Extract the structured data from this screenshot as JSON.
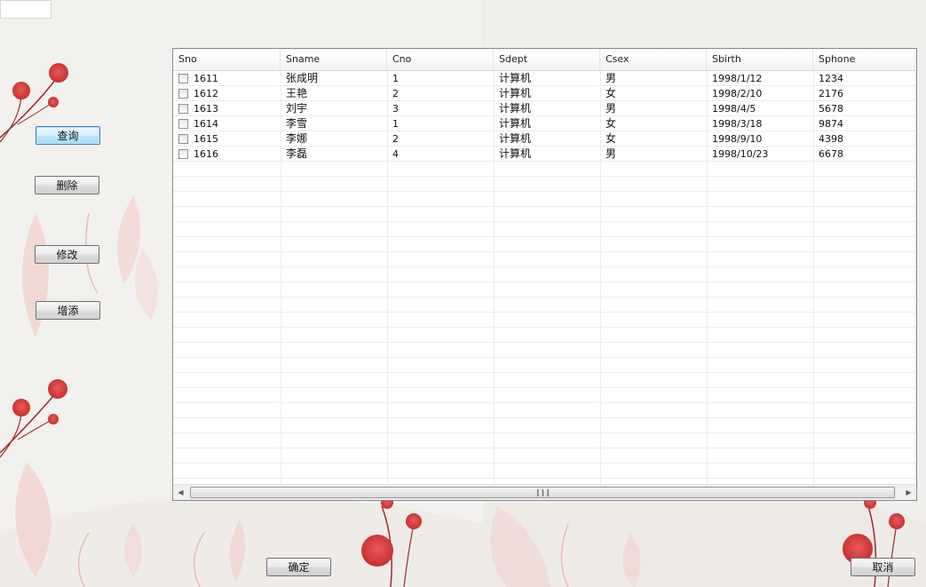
{
  "buttons": {
    "query": "查询",
    "delete": "删除",
    "modify": "修改",
    "add": "增添",
    "confirm": "确定",
    "cancel": "取消"
  },
  "table": {
    "columns": [
      "Sno",
      "Sname",
      "Cno",
      "Sdept",
      "Csex",
      "Sbirth",
      "Sphone"
    ],
    "rows": [
      [
        "1611",
        "张成明",
        "1",
        "计算机",
        "男",
        "1998/1/12",
        "1234"
      ],
      [
        "1612",
        "王艳",
        "2",
        "计算机",
        "女",
        "1998/2/10",
        "2176"
      ],
      [
        "1613",
        "刘宇",
        "3",
        "计算机",
        "男",
        "1998/4/5",
        "5678"
      ],
      [
        "1614",
        "李雪",
        "1",
        "计算机",
        "女",
        "1998/3/18",
        "9874"
      ],
      [
        "1615",
        "李娜",
        "2",
        "计算机",
        "女",
        "1998/9/10",
        "4398"
      ],
      [
        "1616",
        "李磊",
        "4",
        "计算机",
        "男",
        "1998/10/23",
        "6678"
      ]
    ]
  },
  "scrollbar": {
    "left_icon": "chevron-left-icon",
    "right_icon": "chevron-right-icon",
    "grip_icon": "grip-icon"
  },
  "colors": {
    "background": "#f3f1ee",
    "flower_red": "#d23a3a",
    "button_focus": "#3c7fb1"
  }
}
